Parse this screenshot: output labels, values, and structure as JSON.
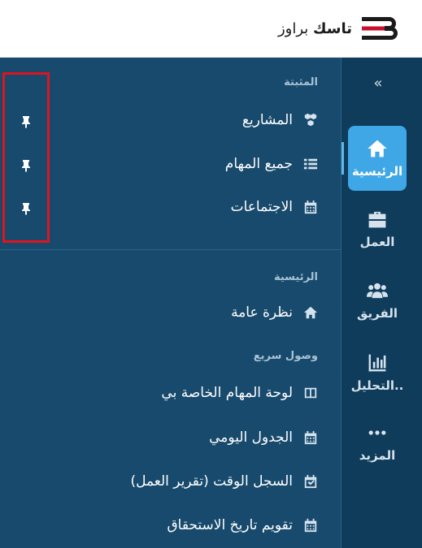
{
  "header": {
    "brand_bold": "تاسك",
    "brand_rest": " براوز"
  },
  "menu": {
    "pinned_title": "المثبتة",
    "pinned": [
      {
        "label": "المشاريع",
        "icon": "cubes-icon"
      },
      {
        "label": "جميع المهام",
        "icon": "list-icon"
      },
      {
        "label": "الاجتماعات",
        "icon": "calendar-icon"
      }
    ],
    "home_title": "الرئيسية",
    "overview": {
      "label": "نظرة عامة",
      "icon": "home-icon"
    },
    "quick_title": "وصول سريع",
    "quick": [
      {
        "label": "لوحة المهام الخاصة بي",
        "icon": "board-icon"
      },
      {
        "label": "الجدول اليومي",
        "icon": "calendar-icon"
      },
      {
        "label": "السجل الوقت (تقرير العمل)",
        "icon": "calendar-check-icon"
      },
      {
        "label": "تقويم تاريخ الاستحقاق",
        "icon": "calendar-icon"
      }
    ]
  },
  "rail": {
    "collapse": "«",
    "items": [
      {
        "label": "الرئيسية",
        "icon": "home-icon"
      },
      {
        "label": "العمل",
        "icon": "briefcase-icon"
      },
      {
        "label": "الفريق",
        "icon": "users-icon"
      },
      {
        "label": "التحليل..",
        "icon": "chart-icon"
      },
      {
        "label": "المزيد",
        "icon": "more-icon"
      }
    ]
  },
  "colors": {
    "menu_bg": "#174a6c",
    "rail_bg": "#0f3c5a",
    "active": "#3fa7e6",
    "highlight_box": "#e0141e"
  }
}
